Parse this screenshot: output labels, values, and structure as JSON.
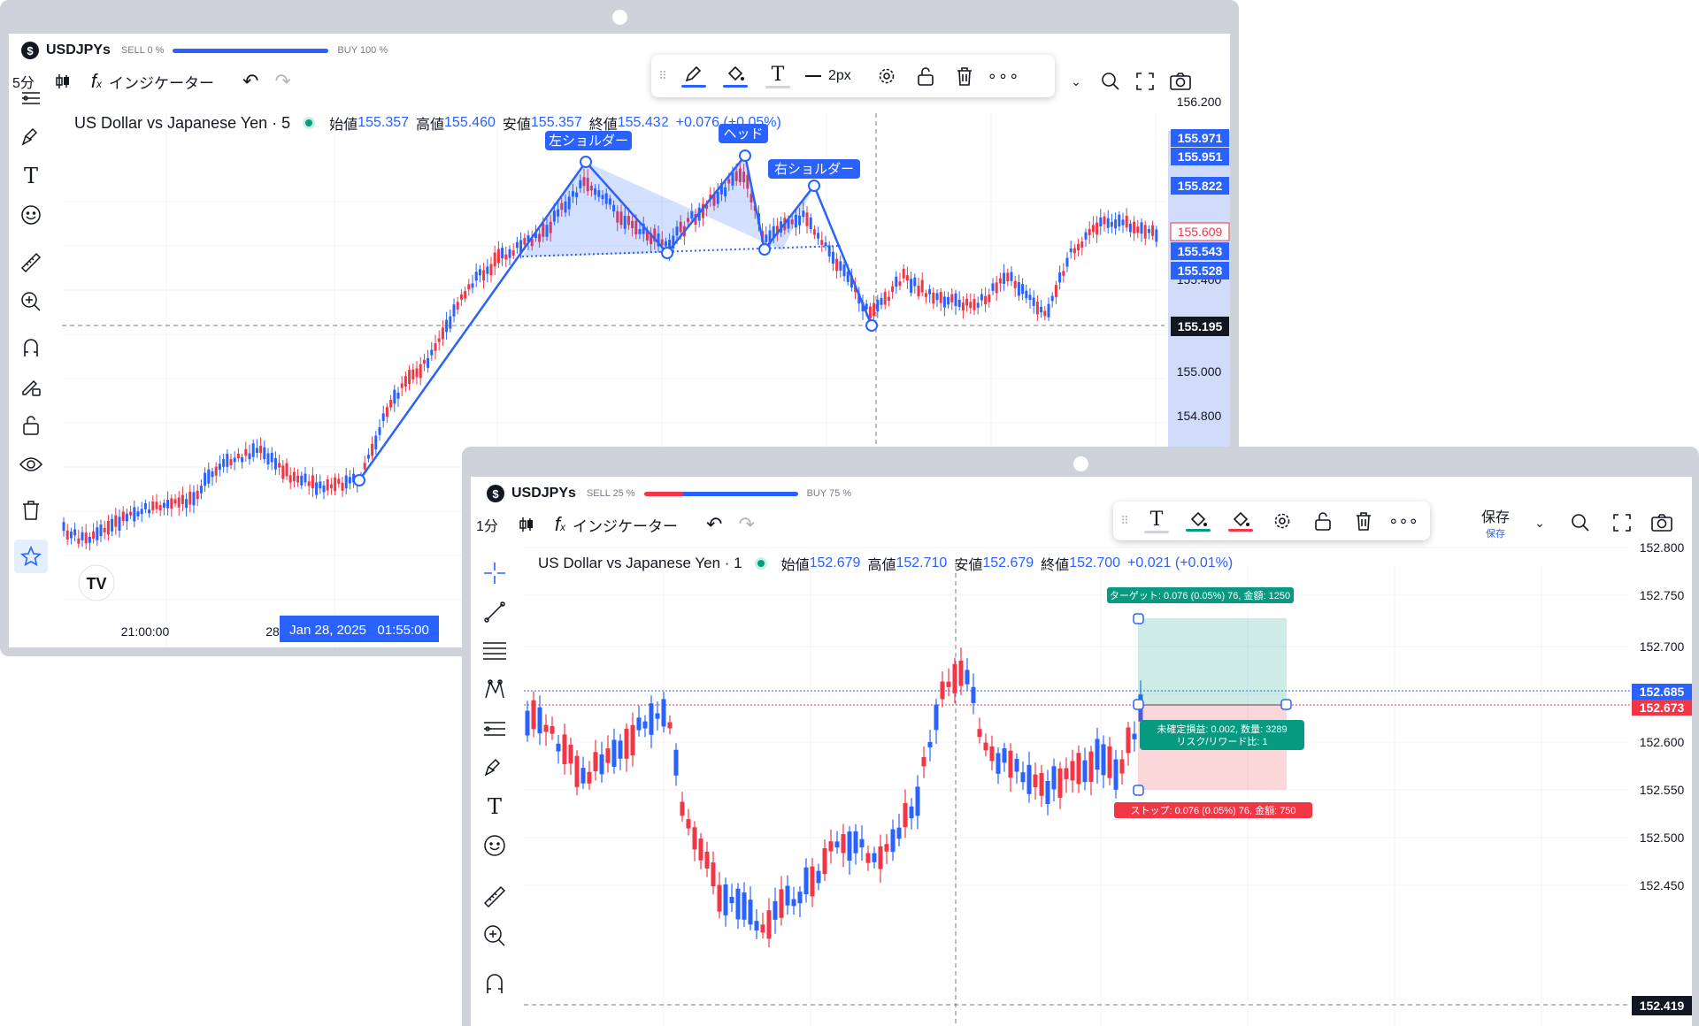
{
  "colors": {
    "up": "#2962ff",
    "down": "#f23645",
    "accent": "#2962ff",
    "target": "#089981",
    "stop": "#f23645",
    "frame": "#cfd1db",
    "crosshair_dark": "#131722"
  },
  "chart1": {
    "symbol": "USDJPYs",
    "sell_label": "SELL 0 %",
    "buy_label": "BUY 100 %",
    "interval": "5分",
    "indicators_label": "インジケーター",
    "stroke_width": "2px",
    "legend": {
      "title": "US Dollar vs Japanese Yen · 5",
      "o_label": "始値",
      "o": "155.357",
      "h_label": "高値",
      "h": "155.460",
      "l_label": "安値",
      "l": "155.357",
      "c_label": "終値",
      "c": "155.432",
      "chg": "+0.076 (+0.05%)"
    },
    "pattern_labels": {
      "left": "左ショルダー",
      "head": "ヘッド",
      "right": "右ショルダー"
    },
    "price_labels": [
      "155.971",
      "155.951",
      "155.822",
      "155.609",
      "155.543",
      "155.528",
      "155.195"
    ],
    "axis_ticks": [
      "156.200",
      "155.400",
      "155.000",
      "154.800"
    ],
    "time_label": "21:00:00",
    "time_label2": "28",
    "crosshair_time": "Jan 28, 2025   01:55:00",
    "logo": "TV"
  },
  "chart2": {
    "symbol": "USDJPYs",
    "sell_label": "SELL 25 %",
    "buy_label": "BUY 75 %",
    "interval": "1分",
    "indicators_label": "インジケーター",
    "save_label": "保存",
    "save_sub": "保存",
    "legend": {
      "title": "US Dollar vs Japanese Yen · 1",
      "o_label": "始値",
      "o": "152.679",
      "h_label": "高値",
      "h": "152.710",
      "l_label": "安値",
      "l": "152.679",
      "c_label": "終値",
      "c": "152.700",
      "chg": "+0.021 (+0.01%)"
    },
    "target_label": "ターゲット: 0.076 (0.05%) 76, 金額: 1250",
    "stop_label": "ストップ: 0.076 (0.05%) 76, 金額: 750",
    "pnl_label": "未確定損益: 0.002, 数量: 3289",
    "rr_label": "リスク/リワード比: 1",
    "axis_ticks": [
      "152.800",
      "152.750",
      "152.700",
      "152.650",
      "152.600",
      "152.550",
      "152.500",
      "152.450"
    ],
    "price_blue": "152.685",
    "price_red": "152.673",
    "price_cross": "152.419"
  }
}
